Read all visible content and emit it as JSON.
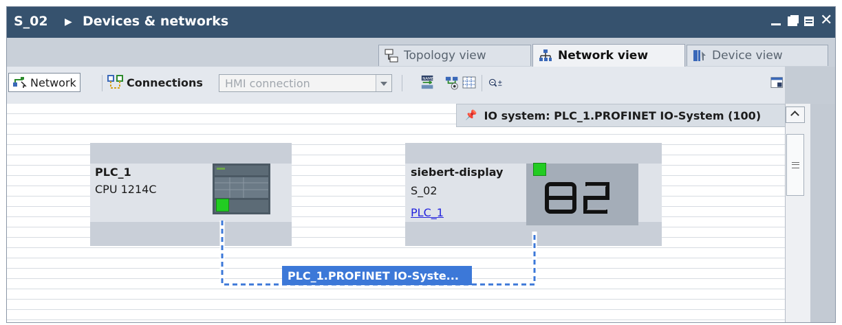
{
  "title": {
    "project": "S_02",
    "separator": "▶",
    "page": "Devices & networks"
  },
  "tabs": [
    {
      "label": "Topology view",
      "icon": "topology-icon",
      "active": false
    },
    {
      "label": "Network view",
      "icon": "network-icon",
      "active": true
    },
    {
      "label": "Device view",
      "icon": "device-icon",
      "active": false
    }
  ],
  "toolbar": {
    "network_label": "Network",
    "connections_label": "Connections",
    "connection_type": "HMI connection"
  },
  "io_system": {
    "label": "IO system: PLC_1.PROFINET IO-System (100)"
  },
  "devices": {
    "plc": {
      "name": "PLC_1",
      "type": "CPU 1214C"
    },
    "display": {
      "name": "siebert-display",
      "type": "S_02",
      "link": "PLC_1"
    }
  },
  "network": {
    "label": "PLC_1.PROFINET IO-Syste..."
  },
  "colors": {
    "titlebar": "#36526e",
    "accent": "#3c78d8",
    "port": "#22cc22"
  }
}
